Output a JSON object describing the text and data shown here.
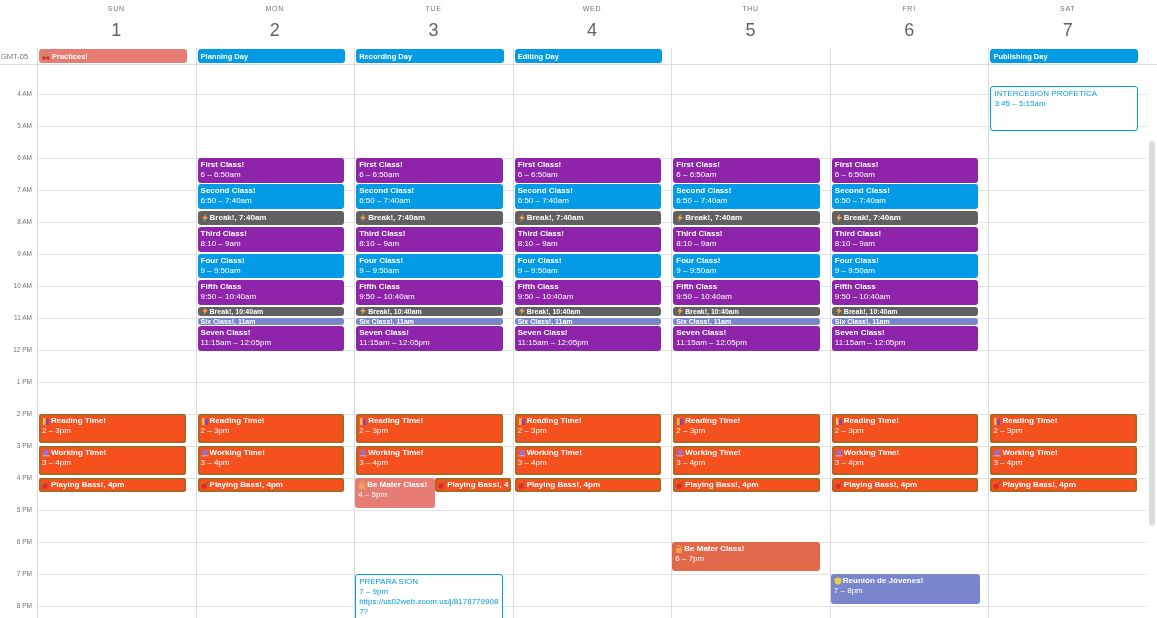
{
  "timezone": "GMT-05",
  "hours": [
    "4 AM",
    "5 AM",
    "6 AM",
    "7 AM",
    "8 AM",
    "9 AM",
    "10 AM",
    "11 AM",
    "12 PM",
    "1 PM",
    "2 PM",
    "3 PM",
    "4 PM",
    "5 PM",
    "6 PM",
    "7 PM",
    "8 PM"
  ],
  "days": [
    {
      "weekday": "SUN",
      "date": "1",
      "all_day": [
        {
          "title": "Practices!",
          "kind": "practice",
          "color": "#e67c73"
        }
      ],
      "events": [
        {
          "title": "Reading Time!",
          "time": "2 – 3pm",
          "kind": "reading",
          "color": "#f4511e"
        },
        {
          "title": "Working Time!",
          "time": "3 – 4pm",
          "kind": "working",
          "color": "#f4511e"
        },
        {
          "title": "Playing Bass!, 4pm",
          "kind": "bass",
          "color": "#f4511e"
        }
      ]
    },
    {
      "weekday": "MON",
      "date": "2",
      "all_day": [
        {
          "title": "Planning Day",
          "kind": "plain",
          "color": "#039be5"
        }
      ],
      "events": [
        {
          "title": "First Class!",
          "time": "6 – 6:50am",
          "kind": "class",
          "color": "#8e24aa"
        },
        {
          "title": "Second Class!",
          "time": "6:50 – 7:40am",
          "kind": "class",
          "color": "#039be5"
        },
        {
          "title": "Break!, 7:40am",
          "kind": "break",
          "color": "#616161"
        },
        {
          "title": "Third Class!",
          "time": "8:10 – 9am",
          "kind": "class",
          "color": "#8e24aa"
        },
        {
          "title": "Four Class!",
          "time": "9 – 9:50am",
          "kind": "class",
          "color": "#039be5"
        },
        {
          "title": "Fifth Class",
          "time": "9:50 – 10:40am",
          "kind": "class",
          "color": "#8e24aa"
        },
        {
          "title": "Break!, 10:40am",
          "kind": "break",
          "color": "#616161"
        },
        {
          "title": "Six Class!, 11am",
          "kind": "class",
          "color": "#7986cb"
        },
        {
          "title": "Seven Class!",
          "time": "11:15am – 12:05pm",
          "kind": "class",
          "color": "#8e24aa"
        },
        {
          "title": "Reading Time!",
          "time": "2 – 3pm",
          "kind": "reading",
          "color": "#f4511e"
        },
        {
          "title": "Working Time!",
          "time": "3 – 4pm",
          "kind": "working",
          "color": "#f4511e"
        },
        {
          "title": "Playing Bass!, 4pm",
          "kind": "bass",
          "color": "#f4511e"
        }
      ]
    },
    {
      "weekday": "TUE",
      "date": "3",
      "all_day": [
        {
          "title": "Recording Day",
          "kind": "plain",
          "color": "#039be5"
        }
      ],
      "events": [
        {
          "title": "First Class!",
          "time": "6 – 6:50am",
          "kind": "class",
          "color": "#8e24aa"
        },
        {
          "title": "Second Class!",
          "time": "6:50 – 7:40am",
          "kind": "class",
          "color": "#039be5"
        },
        {
          "title": "Break!, 7:40am",
          "kind": "break",
          "color": "#616161"
        },
        {
          "title": "Third Class!",
          "time": "8:10 – 9am",
          "kind": "class",
          "color": "#8e24aa"
        },
        {
          "title": "Four Class!",
          "time": "9 – 9:50am",
          "kind": "class",
          "color": "#039be5"
        },
        {
          "title": "Fifth Class",
          "time": "9:50 – 10:40am",
          "kind": "class",
          "color": "#8e24aa"
        },
        {
          "title": "Break!, 10:40am",
          "kind": "break",
          "color": "#616161"
        },
        {
          "title": "Six Class!, 11am",
          "kind": "class",
          "color": "#7986cb"
        },
        {
          "title": "Seven Class!",
          "time": "11:15am – 12:05pm",
          "kind": "class",
          "color": "#8e24aa"
        },
        {
          "title": "Reading Time!",
          "time": "2 – 3pm",
          "kind": "reading",
          "color": "#f4511e"
        },
        {
          "title": "Working Time!",
          "time": "3 – 4pm",
          "kind": "working",
          "color": "#f4511e"
        },
        {
          "title": "Be Mater Class!",
          "time": "4 – 5pm",
          "kind": "workshop",
          "color": "#e67c73"
        },
        {
          "title": "Playing Bass!, 4",
          "kind": "bass",
          "color": "#f4511e"
        },
        {
          "title": "PREPARA SION",
          "time": "7 – 9pm",
          "description": "https://us02web.zoom.us/j/81787799087?",
          "kind": "outlined",
          "color": "#039be5"
        }
      ]
    },
    {
      "weekday": "WED",
      "date": "4",
      "all_day": [
        {
          "title": "Editing Day",
          "kind": "plain",
          "color": "#039be5"
        }
      ],
      "events": [
        {
          "title": "First Class!",
          "time": "6 – 6:50am",
          "kind": "class",
          "color": "#8e24aa"
        },
        {
          "title": "Second Class!",
          "time": "6:50 – 7:40am",
          "kind": "class",
          "color": "#039be5"
        },
        {
          "title": "Break!, 7:40am",
          "kind": "break",
          "color": "#616161"
        },
        {
          "title": "Third Class!",
          "time": "8:10 – 9am",
          "kind": "class",
          "color": "#8e24aa"
        },
        {
          "title": "Four Class!",
          "time": "9 – 9:50am",
          "kind": "class",
          "color": "#039be5"
        },
        {
          "title": "Fifth Class",
          "time": "9:50 – 10:40am",
          "kind": "class",
          "color": "#8e24aa"
        },
        {
          "title": "Break!, 10:40am",
          "kind": "break",
          "color": "#616161"
        },
        {
          "title": "Six Class!, 11am",
          "kind": "class",
          "color": "#7986cb"
        },
        {
          "title": "Seven Class!",
          "time": "11:15am – 12:05pm",
          "kind": "class",
          "color": "#8e24aa"
        },
        {
          "title": "Reading Time!",
          "time": "2 – 3pm",
          "kind": "reading",
          "color": "#f4511e"
        },
        {
          "title": "Working Time!",
          "time": "3 – 4pm",
          "kind": "working",
          "color": "#f4511e"
        },
        {
          "title": "Playing Bass!, 4pm",
          "kind": "bass",
          "color": "#f4511e"
        }
      ]
    },
    {
      "weekday": "THU",
      "date": "5",
      "events": [
        {
          "title": "First Class!",
          "time": "6 – 6:50am",
          "kind": "class",
          "color": "#8e24aa"
        },
        {
          "title": "Second Class!",
          "time": "6:50 – 7:40am",
          "kind": "class",
          "color": "#039be5"
        },
        {
          "title": "Break!, 7:40am",
          "kind": "break",
          "color": "#616161"
        },
        {
          "title": "Third Class!",
          "time": "8:10 – 9am",
          "kind": "class",
          "color": "#8e24aa"
        },
        {
          "title": "Four Class!",
          "time": "9 – 9:50am",
          "kind": "class",
          "color": "#039be5"
        },
        {
          "title": "Fifth Class",
          "time": "9:50 – 10:40am",
          "kind": "class",
          "color": "#8e24aa"
        },
        {
          "title": "Break!, 10:40am",
          "kind": "break",
          "color": "#616161"
        },
        {
          "title": "Six Class!, 11am",
          "kind": "class",
          "color": "#7986cb"
        },
        {
          "title": "Seven Class!",
          "time": "11:15am – 12:05pm",
          "kind": "class",
          "color": "#8e24aa"
        },
        {
          "title": "Reading Time!",
          "time": "2 – 3pm",
          "kind": "reading",
          "color": "#f4511e"
        },
        {
          "title": "Working Time!",
          "time": "3 – 4pm",
          "kind": "working",
          "color": "#f4511e"
        },
        {
          "title": "Playing Bass!, 4pm",
          "kind": "bass",
          "color": "#f4511e"
        },
        {
          "title": "Be Mater Class!",
          "time": "6 – 7pm",
          "kind": "workshop",
          "color": "#e1694a"
        }
      ]
    },
    {
      "weekday": "FRI",
      "date": "6",
      "events": [
        {
          "title": "First Class!",
          "time": "6 – 6:50am",
          "kind": "class",
          "color": "#8e24aa"
        },
        {
          "title": "Second Class!",
          "time": "6:50 – 7:40am",
          "kind": "class",
          "color": "#039be5"
        },
        {
          "title": "Break!, 7:40am",
          "kind": "break",
          "color": "#616161"
        },
        {
          "title": "Third Class!",
          "time": "8:10 – 9am",
          "kind": "class",
          "color": "#8e24aa"
        },
        {
          "title": "Four Class!",
          "time": "9 – 9:50am",
          "kind": "class",
          "color": "#039be5"
        },
        {
          "title": "Fifth Class",
          "time": "9:50 – 10:40am",
          "kind": "class",
          "color": "#8e24aa"
        },
        {
          "title": "Break!, 10:40am",
          "kind": "break",
          "color": "#616161"
        },
        {
          "title": "Six Class!, 11am",
          "kind": "class",
          "color": "#7986cb"
        },
        {
          "title": "Seven Class!",
          "time": "11:15am – 12:05pm",
          "kind": "class",
          "color": "#8e24aa"
        },
        {
          "title": "Reading Time!",
          "time": "2 – 3pm",
          "kind": "reading",
          "color": "#f4511e"
        },
        {
          "title": "Working Time!",
          "time": "3 – 4pm",
          "kind": "working",
          "color": "#f4511e"
        },
        {
          "title": "Playing Bass!, 4pm",
          "kind": "bass",
          "color": "#f4511e"
        },
        {
          "title": "Reunión de Jóvenes!",
          "time": "7 – 8pm",
          "kind": "meeting",
          "color": "#7986cb"
        }
      ]
    },
    {
      "weekday": "SAT",
      "date": "7",
      "all_day": [
        {
          "title": "Publishing Day",
          "kind": "plain",
          "color": "#039be5"
        }
      ],
      "events": [
        {
          "title": "INTERCESION PROFETICA",
          "time": "3:45 – 5:15am",
          "kind": "outlined",
          "color": "#039be5"
        },
        {
          "title": "Reading Time!",
          "time": "2 – 3pm",
          "kind": "reading",
          "color": "#f4511e"
        },
        {
          "title": "Working Time!",
          "time": "3 – 4pm",
          "kind": "working",
          "color": "#f4511e"
        },
        {
          "title": "Playing Bass!, 4pm",
          "kind": "bass",
          "color": "#f4511e"
        }
      ]
    }
  ]
}
